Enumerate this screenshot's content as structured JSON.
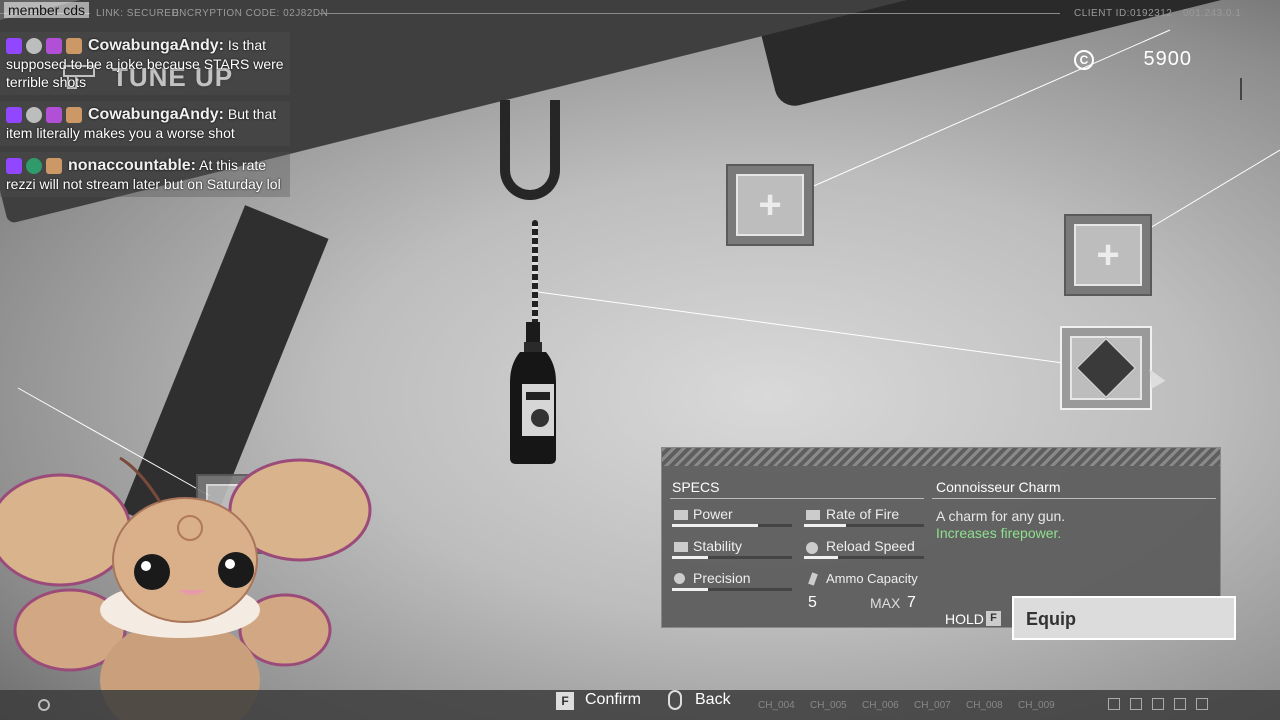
{
  "topbar": {
    "link_status": "LINK: SECURED",
    "encryption": "ENCRYPTION CODE: 02J82DN",
    "client_id": "CLIENT ID:0192312",
    "version": "001.243.0.1"
  },
  "overlay": {
    "member_cds": "member cds"
  },
  "header": {
    "title": "TUNE UP"
  },
  "currency": {
    "value": "5900",
    "symbol": "C"
  },
  "chat": [
    {
      "user": "CowabungaAndy:",
      "text": "Is that supposed to be a joke because STARS were terrible shots"
    },
    {
      "user": "CowabungaAndy:",
      "text": "But that item literally makes you a worse shot"
    },
    {
      "user": "nonaccountable:",
      "text": "At this rate rezzi will not stream later but on Saturday lol"
    }
  ],
  "slots": {
    "plus": "+"
  },
  "specs": {
    "label": "SPECS",
    "stats": {
      "power": {
        "label": "Power",
        "level": 0.72
      },
      "rate_of_fire": {
        "label": "Rate of Fire",
        "level": 0.35
      },
      "stability": {
        "label": "Stability",
        "level": 0.3
      },
      "reload_speed": {
        "label": "Reload Speed",
        "level": 0.28
      },
      "precision": {
        "label": "Precision",
        "level": 0.3
      },
      "ammo_capacity": {
        "label": "Ammo Capacity"
      }
    },
    "ammo_current": "5",
    "ammo_max_label": "MAX",
    "ammo_max": "7"
  },
  "item": {
    "name": "Connoisseur Charm",
    "description": "A charm for any gun.",
    "effect": "Increases firepower."
  },
  "equip": {
    "hold_label": "HOLD",
    "key": "F",
    "button_label": "Equip"
  },
  "bottombar": {
    "confirm_key": "F",
    "confirm_label": "Confirm",
    "back_label": "Back",
    "channels": [
      "CH_004",
      "CH_005",
      "CH_006",
      "CH_007",
      "CH_008",
      "CH_009"
    ]
  },
  "colors": {
    "effect_green": "#8fe08f",
    "chat_badge_purple": "#9146ff"
  }
}
